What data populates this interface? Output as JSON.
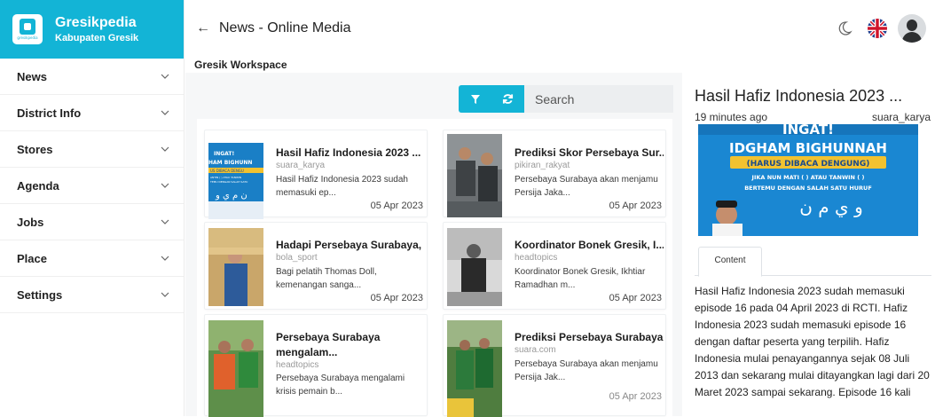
{
  "brand": {
    "title": "Gresikpedia",
    "subtitle": "Kabupaten Gresik",
    "logo_caption": "gresikpedia"
  },
  "sidebar": {
    "items": [
      {
        "label": "News"
      },
      {
        "label": "District Info"
      },
      {
        "label": "Stores"
      },
      {
        "label": "Agenda"
      },
      {
        "label": "Jobs"
      },
      {
        "label": "Place"
      },
      {
        "label": "Settings"
      }
    ]
  },
  "header": {
    "back_icon": "arrow-left-icon",
    "title": "News - Online Media"
  },
  "workspace": {
    "label": "Gresik Workspace"
  },
  "toolbar": {
    "search_placeholder": "Search",
    "filter_icon": "filter-icon",
    "refresh_icon": "refresh-icon"
  },
  "cards": [
    {
      "title": "Hasil Hafiz Indonesia 2023 ...",
      "source": "suara_karya",
      "desc": "Hasil Hafiz Indonesia 2023 sudah memasuki ep...",
      "date": "05 Apr 2023"
    },
    {
      "title": "Prediksi Skor Persebaya Sur...",
      "source": "pikiran_rakyat",
      "desc": "Persebaya Surabaya akan menjamu Persija Jaka...",
      "date": "05 Apr 2023"
    },
    {
      "title": "Hadapi Persebaya Surabaya, ...",
      "source": "bola_sport",
      "desc": "Bagi pelatih Thomas Doll, kemenangan sanga...",
      "date": "05 Apr 2023"
    },
    {
      "title": "Koordinator Bonek Gresik, I...",
      "source": "headtopics",
      "desc": "Koordinator Bonek Gresik, Ikhtiar Ramadhan m...",
      "date": "05 Apr 2023"
    },
    {
      "title": "Persebaya Surabaya mengalam...",
      "source": "headtopics",
      "desc": "Persebaya Surabaya mengalami krisis pemain b...",
      "date": ""
    },
    {
      "title": "Prediksi Persebaya Surabaya...",
      "source": "suara.com",
      "desc": "Persebaya Surabaya akan menjamu Persija Jak...",
      "date": "05 Apr 2023"
    }
  ],
  "thumb_text": {
    "card0": [
      "INGAT!",
      "HAM BIGHUNN",
      "US DIBACA DENGU",
      "ANTIN ( ) ATAU TANWIN",
      "TEMU DENGAN SALAH SATU"
    ]
  },
  "detail": {
    "title": "Hasil Hafiz Indonesia 2023 ...",
    "time": "19 minutes ago",
    "source": "suara_karya",
    "image_text": {
      "line1": "INGAT!",
      "line2": "IDGHAM BIGHUNNAH",
      "line3": "(HARUS DIBACA DENGUNG)",
      "line4": "JIKA NUN MATI ( ) ATAU TANWIN ( )",
      "line5": "BERTEMU DENGAN SALAH SATU HURUF",
      "line6": "ﻭ ﻱ ﻡ ﻥ"
    },
    "tab_label": "Content",
    "body": "Hasil Hafiz Indonesia 2023 sudah memasuki episode 16 pada 04 April 2023 di RCTI. Hafiz Indonesia 2023 sudah memasuki episode 16 dengan daftar peserta yang terpilih. Hafiz Indonesia mulai penayangannya sejak 08 Juli 2013 dan sekarang mulai ditayangkan lagi dari 20 Maret 2023 sampai sekarang. Episode 16 kali"
  },
  "colors": {
    "accent": "#13b4d6",
    "content_bg": "#f6f7f8"
  }
}
